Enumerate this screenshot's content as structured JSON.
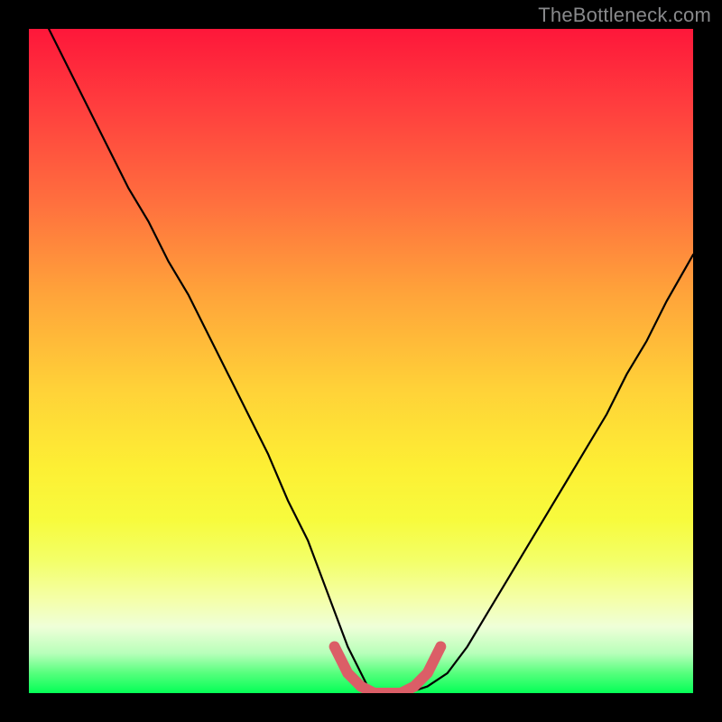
{
  "watermark": "TheBottleneck.com",
  "palette": {
    "page_bg": "#000000",
    "gradient_top": "#fe173a",
    "gradient_bottom": "#04ff56",
    "curve_main": "#000000",
    "curve_mark": "#db5e67",
    "watermark_text": "#88898b"
  },
  "chart_data": {
    "type": "line",
    "title": "",
    "xlabel": "",
    "ylabel": "",
    "xlim": [
      0,
      100
    ],
    "ylim": [
      0,
      100
    ],
    "grid": false,
    "legend": false,
    "series": [
      {
        "name": "bottleneck-curve",
        "color": "#000000",
        "x": [
          0,
          3,
          6,
          9,
          12,
          15,
          18,
          21,
          24,
          27,
          30,
          33,
          36,
          39,
          42,
          45,
          48,
          51,
          54,
          57,
          60,
          63,
          66,
          69,
          72,
          75,
          78,
          81,
          84,
          87,
          90,
          93,
          96,
          100
        ],
        "y": [
          106,
          100,
          94,
          88,
          82,
          76,
          71,
          65,
          60,
          54,
          48,
          42,
          36,
          29,
          23,
          15,
          7,
          1,
          0,
          0,
          1,
          3,
          7,
          12,
          17,
          22,
          27,
          32,
          37,
          42,
          48,
          53,
          59,
          66
        ]
      },
      {
        "name": "optimal-band-marker",
        "color": "#db5e67",
        "x": [
          46,
          48,
          50,
          52,
          54,
          56,
          58,
          60,
          62
        ],
        "y": [
          7,
          3,
          1,
          0,
          0,
          0,
          1,
          3,
          7
        ]
      }
    ],
    "annotations": []
  }
}
